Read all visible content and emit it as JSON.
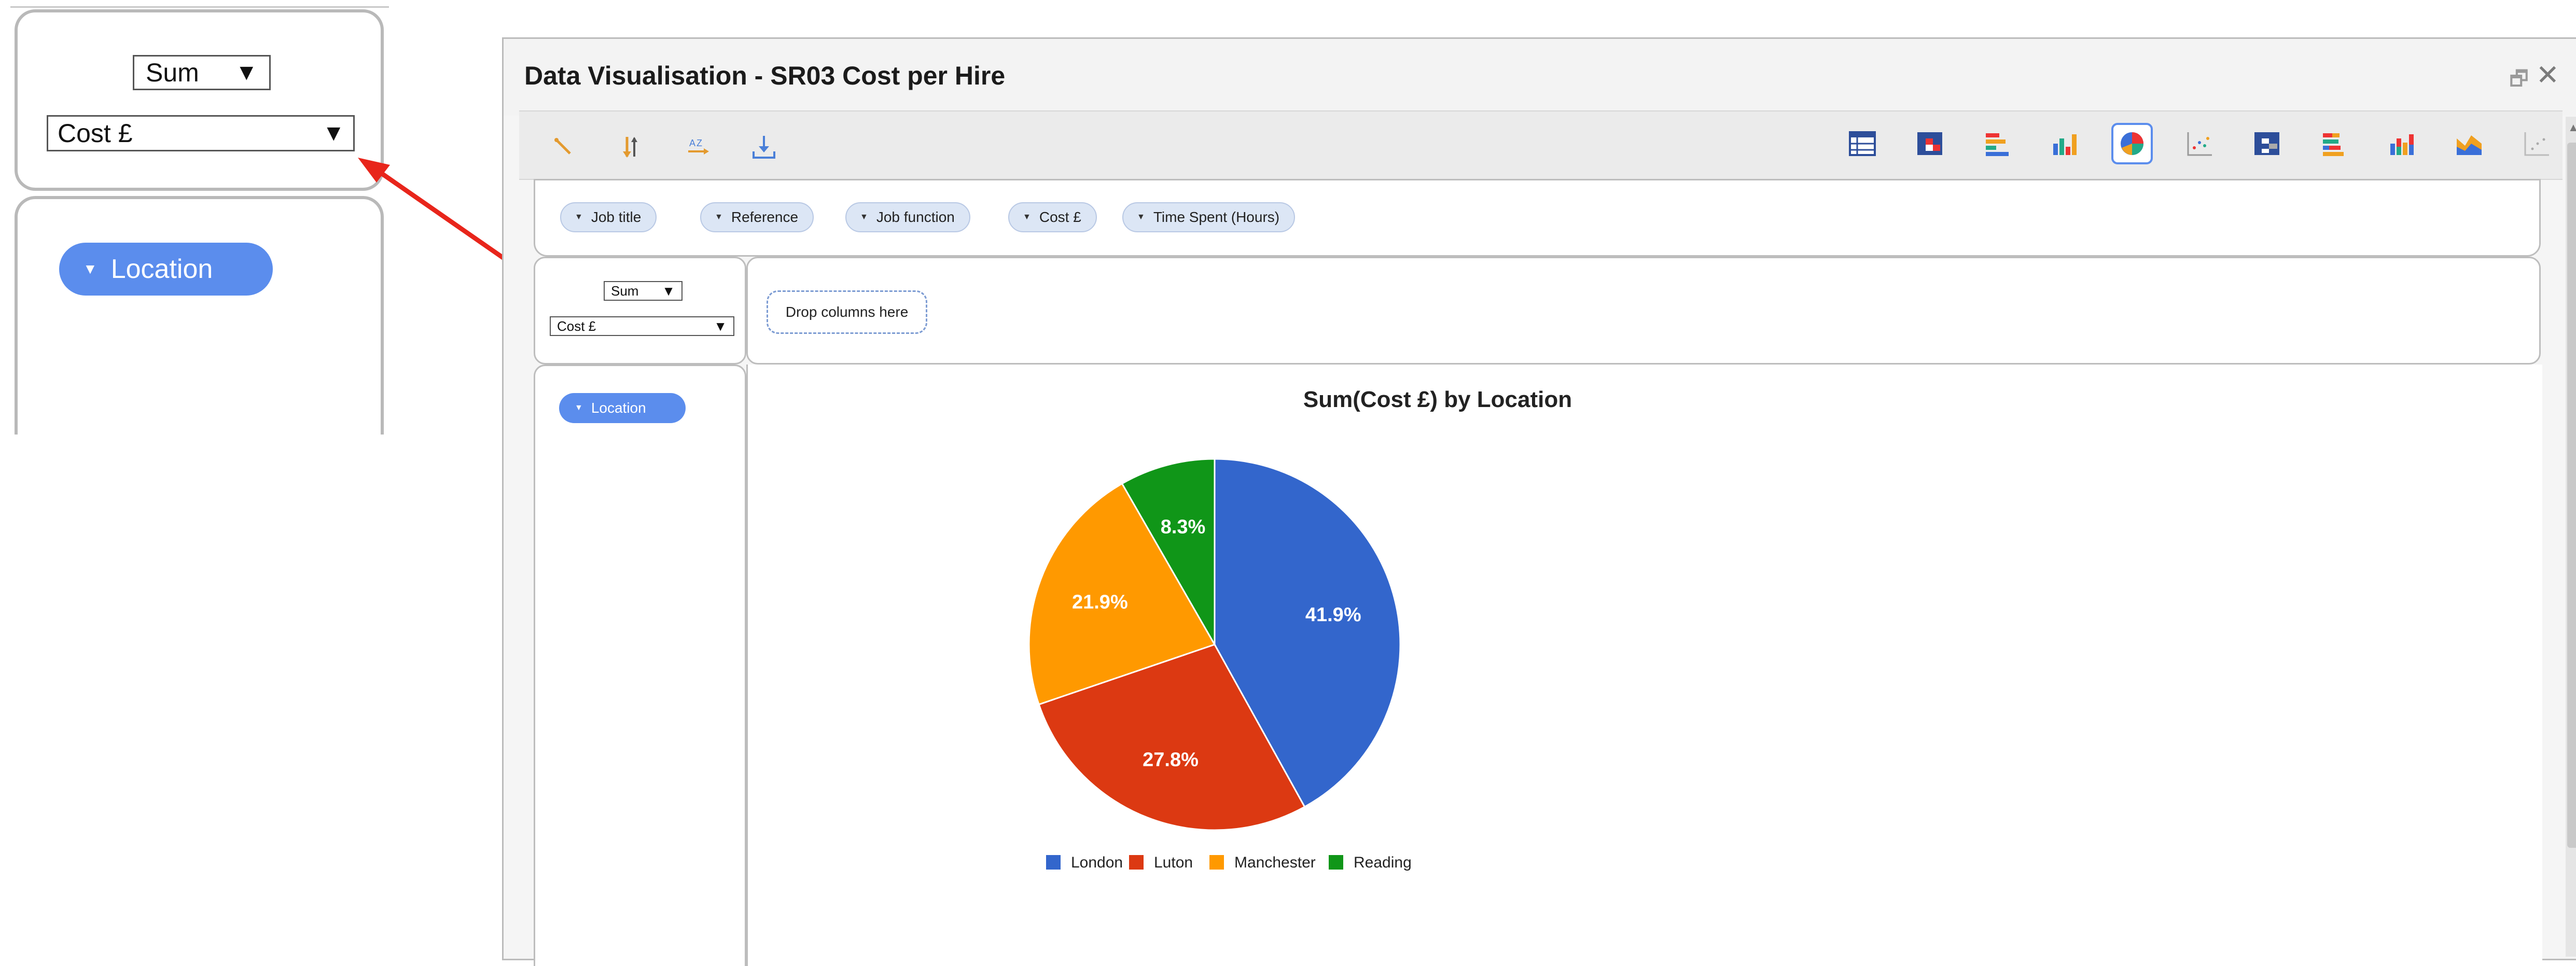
{
  "zoom": {
    "aggregator_select": "Sum",
    "value_field_select": "Cost £",
    "row_pill": "Location"
  },
  "window": {
    "title": "Data Visualisation - SR03 Cost per Hire",
    "controls": [
      "restore-icon",
      "close-icon"
    ]
  },
  "toolbar": {
    "left_icons": [
      "clear-icon",
      "sort-icon",
      "sort-az-icon",
      "download-icon"
    ],
    "chart_types": [
      "table-icon",
      "heatmap-icon",
      "horizontal-bar-icon",
      "bar-chart-icon",
      "pie-chart-icon",
      "scatter-icon",
      "table-heatmap-icon",
      "stacked-horizontal-bar-icon",
      "stacked-bar-icon",
      "area-chart-icon",
      "scatter-plot-icon"
    ],
    "active_chart": "pie-chart-icon"
  },
  "attributes": [
    "Job title",
    "Reference",
    "Job function",
    "Cost £",
    "Time Spent (Hours)"
  ],
  "aggregator": {
    "function": "Sum",
    "field": "Cost £"
  },
  "columns_drop_zone": "Drop columns here",
  "rows": [
    "Location"
  ],
  "colors": {
    "accent": "#5b8ded",
    "pill_bg": "#dce6f5",
    "arrow": "#e8251b"
  },
  "chart_data": {
    "type": "pie",
    "title": "Sum(Cost £) by Location",
    "categories": [
      "London",
      "Luton",
      "Manchester",
      "Reading"
    ],
    "values": [
      41.9,
      27.8,
      21.9,
      8.3
    ],
    "labels": [
      "41.9%",
      "27.8%",
      "21.9%",
      "8.3%"
    ],
    "colors": [
      "#3366cc",
      "#dc3912",
      "#ff9900",
      "#109618"
    ],
    "legend": "bottom"
  }
}
